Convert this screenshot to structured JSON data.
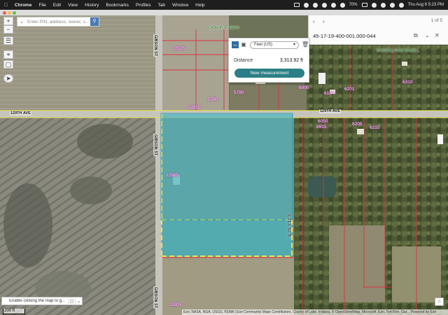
{
  "menubar": {
    "app": "Chrome",
    "items": [
      "File",
      "Edit",
      "View",
      "History",
      "Bookmarks",
      "Profiles",
      "Tab",
      "Window",
      "Help"
    ],
    "battery": "70%",
    "datetime": "Thu Aug 6  5:23 PM"
  },
  "search": {
    "placeholder": "Enter PIN, address, owner, s..."
  },
  "panel": {
    "pager": "1 of 5",
    "parcel_id": "45-17-19-400-001.000-044"
  },
  "measure": {
    "unit": "Feet (US)",
    "distance_label": "Distance",
    "distance_value": "3,313.92 ft",
    "new_button": "New measurement"
  },
  "map": {
    "roads": [
      "129TH AVE",
      "129TH AVE",
      "GIBSON ST",
      "GIBSON ST",
      "GIBSON ST"
    ],
    "subdivisions": [
      "Gibson Estates",
      "WOODLAND KNOLL"
    ],
    "addresses": [
      "12975",
      "5790",
      "5780",
      "12800",
      "6000",
      "6050",
      "6104",
      "6201",
      "6310",
      "12985",
      "6205",
      "6215",
      "6915",
      "12805",
      "12815"
    ],
    "measurement_label": "3,313.92 ft"
  },
  "bottom": {
    "hint": "Enable clicking the map to g...",
    "scale": "200 ft",
    "attribution": "Esri, NASA, NGA, USGS, FEMA | Esri Community Maps Contributors, County of Lake, Indiana, © OpenStreetMap, Microsoft, Esri, TomTom, Gar...    Powered by Esri"
  },
  "colors": {
    "measure_fill": "#3fb6c4",
    "measure_line": "#f4e04d",
    "parcel_line": "#d9343b",
    "button": "#2c7f86"
  }
}
